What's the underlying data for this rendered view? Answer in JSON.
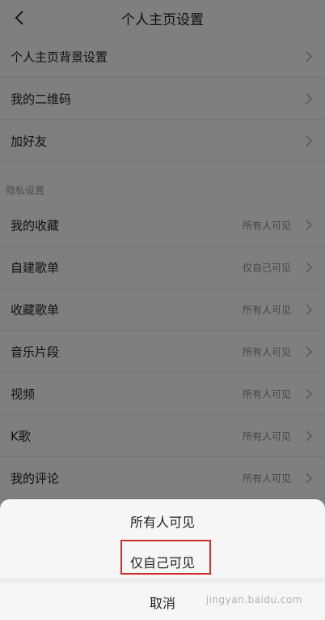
{
  "header": {
    "title": "个人主页设置"
  },
  "settings": {
    "rows": [
      {
        "label": "个人主页背景设置",
        "value": ""
      },
      {
        "label": "我的二维码",
        "value": ""
      },
      {
        "label": "加好友",
        "value": ""
      }
    ],
    "privacy_section_title": "隐私设置",
    "privacy_rows": [
      {
        "label": "我的收藏",
        "value": "所有人可见"
      },
      {
        "label": "自建歌单",
        "value": "仅自己可见"
      },
      {
        "label": "收藏歌单",
        "value": "所有人可见"
      },
      {
        "label": "音乐片段",
        "value": "所有人可见"
      },
      {
        "label": "视频",
        "value": "所有人可见"
      },
      {
        "label": "K歌",
        "value": "所有人可见"
      },
      {
        "label": "我的评论",
        "value": "所有人可见"
      }
    ]
  },
  "bottom_sheet": {
    "option_all": "所有人可见",
    "option_self": "仅自己可见",
    "cancel": "取消"
  },
  "watermark": {
    "text": "jingyan.baidu.com"
  },
  "colors": {
    "overlay": "#000000",
    "highlight": "#d32f2f",
    "value_text": "#8a8a8a"
  }
}
